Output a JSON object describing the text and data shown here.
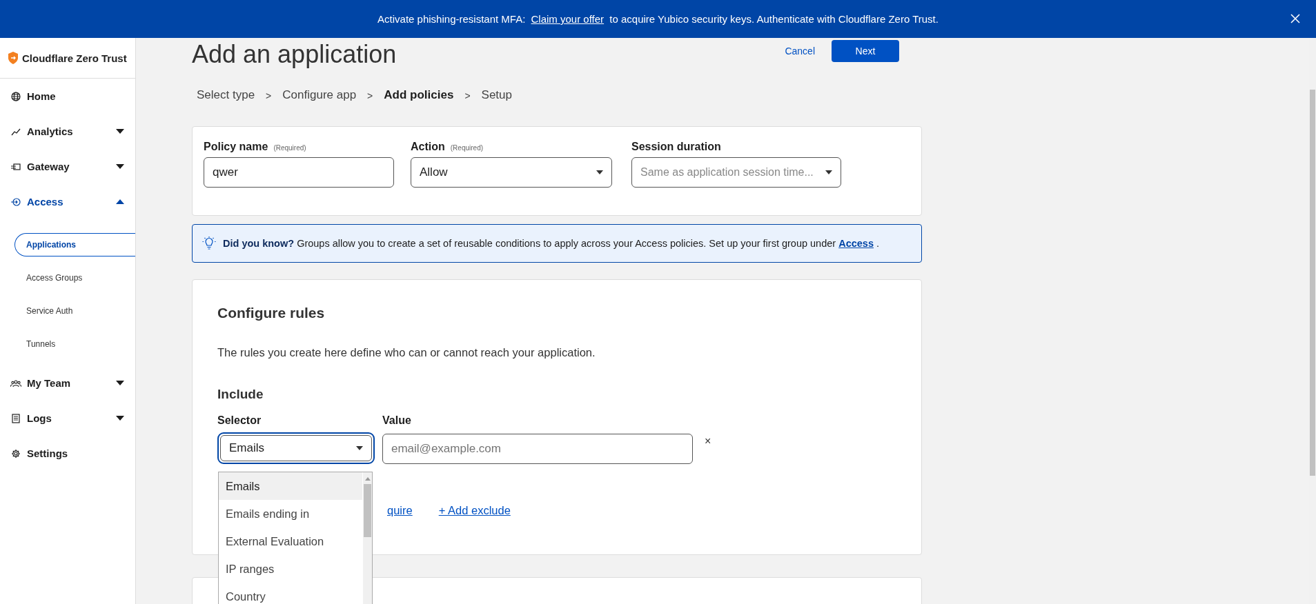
{
  "banner": {
    "text_before": "Activate phishing-resistant MFA:",
    "link": "Claim your offer",
    "text_after": "to acquire Yubico security keys. Authenticate with Cloudflare Zero Trust."
  },
  "sidebar": {
    "brand": "Cloudflare Zero Trust",
    "items": [
      {
        "label": "Home",
        "selected": false
      },
      {
        "label": "Analytics",
        "selected": false,
        "expanded": false
      },
      {
        "label": "Gateway",
        "selected": false,
        "expanded": false
      },
      {
        "label": "Access",
        "selected": true,
        "expanded": true,
        "children": [
          {
            "label": "Applications",
            "selected": true
          },
          {
            "label": "Access Groups",
            "selected": false
          },
          {
            "label": "Service Auth",
            "selected": false
          },
          {
            "label": "Tunnels",
            "selected": false
          }
        ]
      },
      {
        "label": "My Team",
        "selected": false,
        "expanded": false
      },
      {
        "label": "Logs",
        "selected": false,
        "expanded": false
      },
      {
        "label": "Settings",
        "selected": false
      }
    ]
  },
  "page": {
    "title": "Add an application",
    "cancel": "Cancel",
    "next": "Next"
  },
  "steps": [
    {
      "label": "Select type",
      "selected": false,
      "separator": ">"
    },
    {
      "label": "Configure app",
      "selected": false,
      "separator": ">"
    },
    {
      "label": "Add policies",
      "selected": true,
      "separator": ">"
    },
    {
      "label": "Setup",
      "selected": false
    }
  ],
  "policy": {
    "fields": [
      {
        "kind": "input",
        "label": "Policy name",
        "note": "(Required)",
        "value": "qwer"
      },
      {
        "kind": "select",
        "label": "Action",
        "note": "(Required)",
        "value": "Allow"
      },
      {
        "kind": "select",
        "label": "Session duration",
        "placeholder": "Same as application session time..."
      }
    ]
  },
  "tip": {
    "text": "**Did you know?** Groups allow you to create a set of reusable conditions to apply across your Access policies. Set up your first group under",
    "link": "Access",
    "end": "."
  },
  "rules": {
    "title": "Configure rules",
    "description": "The rules you create here define who can or cannot reach your application.",
    "include": "Include",
    "selector_label": "Selector",
    "selector_value": "Emails",
    "value_label": "Value",
    "value_placeholder": "email@example.com",
    "remove": "×",
    "options": [
      {
        "label": "Emails",
        "selected": true
      },
      {
        "label": "Emails ending in",
        "selected": false
      },
      {
        "label": "External Evaluation",
        "selected": false
      },
      {
        "label": "IP ranges",
        "selected": false
      },
      {
        "label": "Country",
        "selected": false
      }
    ],
    "links": [
      "quire",
      "+ Add exclude"
    ]
  }
}
